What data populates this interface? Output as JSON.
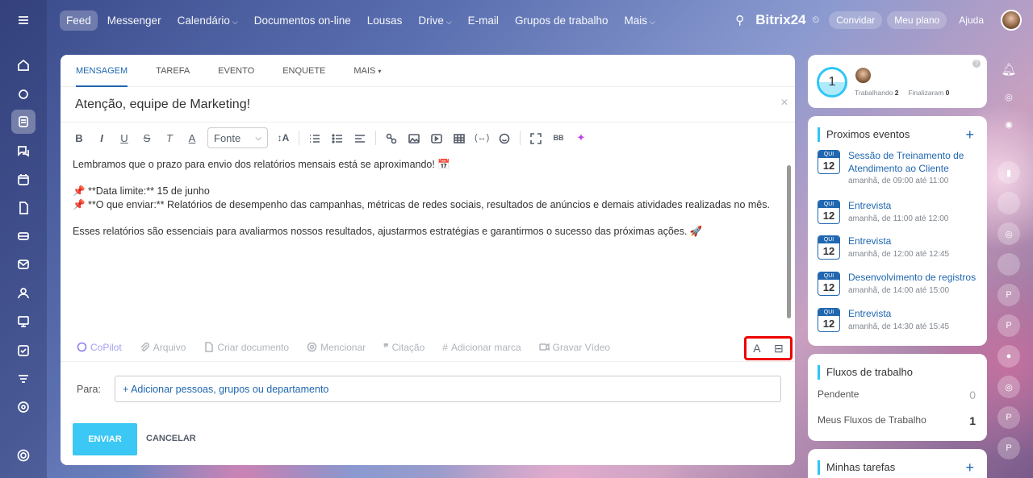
{
  "nav": {
    "items": [
      "Feed",
      "Messenger",
      "Calendário",
      "Documentos on-line",
      "Lousas",
      "Drive",
      "E-mail",
      "Grupos de trabalho",
      "Mais"
    ],
    "brand": "Bitrix",
    "brand_num": "24",
    "invite": "Convidar",
    "plan": "Meu plano",
    "help": "Ajuda"
  },
  "composer": {
    "tabs": [
      "MENSAGEM",
      "TAREFA",
      "EVENTO",
      "ENQUETE",
      "MAIS"
    ],
    "title": "Atenção, equipe de Marketing!",
    "font_label": "Fonte",
    "body": [
      "Lembramos que o prazo para envio dos relatórios mensais está se aproximando! 📅",
      "",
      "📌 **Data limite:** 15 de junho",
      "📌 **O que enviar:** Relatórios de desempenho das campanhas, métricas de redes sociais, resultados de anúncios e demais atividades realizadas no mês.",
      "",
      "Esses relatórios são essenciais para avaliarmos nossos resultados, ajustarmos estratégias e garantirmos o sucesso das próximas ações. 🚀"
    ],
    "actions": [
      "CoPilot",
      "Arquivo",
      "Criar documento",
      "Mencionar",
      "Citação",
      "Adicionar marca",
      "Gravar Vídeo"
    ],
    "to_label": "Para:",
    "add_recipients": "+ Adicionar pessoas, grupos ou departamento",
    "send": "ENVIAR",
    "cancel": "CANCELAR"
  },
  "worktime": {
    "count": "1",
    "working_label": "Trabalhando",
    "working": "2",
    "finished_label": "Finalizaram",
    "finished": "0"
  },
  "events": {
    "title": "Proximos eventos",
    "list": [
      {
        "day": "QUI",
        "num": "12",
        "title": "Sessão de Treinamento de Atendimento ao Cliente",
        "time": "amanhã, de 09:00 até 11:00"
      },
      {
        "day": "QUI",
        "num": "12",
        "title": "Entrevista",
        "time": "amanhã, de 11:00 até 12:00"
      },
      {
        "day": "QUI",
        "num": "12",
        "title": "Entrevista",
        "time": "amanhã, de 12:00 até 12:45"
      },
      {
        "day": "QUI",
        "num": "12",
        "title": "Desenvolvimento de registros",
        "time": "amanhã, de 14:00 até 15:00"
      },
      {
        "day": "QUI",
        "num": "12",
        "title": "Entrevista",
        "time": "amanhã, de 14:30 até 15:45"
      }
    ]
  },
  "workflows": {
    "title": "Fluxos de trabalho",
    "pending_label": "Pendente",
    "pending": "0",
    "mine_label": "Meus Fluxos de Trabalho",
    "mine": "1"
  },
  "tasks": {
    "title": "Minhas tarefas"
  }
}
